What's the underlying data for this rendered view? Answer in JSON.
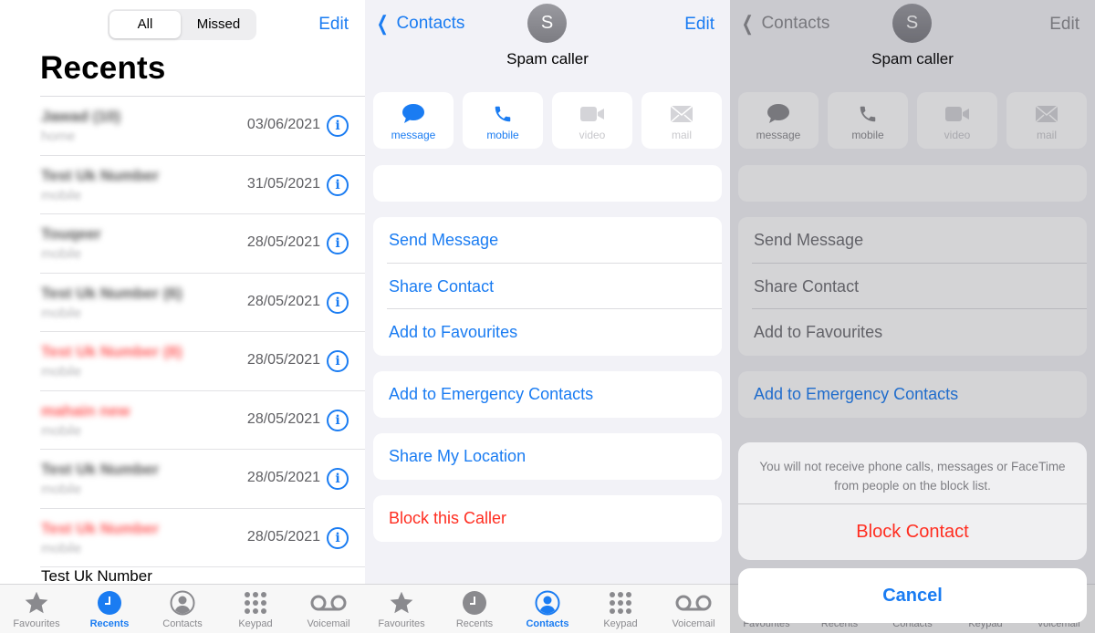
{
  "colors": {
    "accent": "#1a7cf2",
    "destructive": "#ff2d20",
    "missed": "#ff5a5a"
  },
  "recents": {
    "segment": {
      "all": "All",
      "missed": "Missed"
    },
    "edit": "Edit",
    "title": "Recents",
    "rows": [
      {
        "name": "Jawad (10)",
        "type": "home",
        "date": "03/06/2021",
        "missed": false
      },
      {
        "name": "Test Uk Number",
        "type": "mobile",
        "date": "31/05/2021",
        "missed": false
      },
      {
        "name": "Touqeer",
        "type": "mobile",
        "date": "28/05/2021",
        "missed": false
      },
      {
        "name": "Test Uk Number (6)",
        "type": "mobile",
        "date": "28/05/2021",
        "missed": false
      },
      {
        "name": "Test Uk Number (8)",
        "type": "mobile",
        "date": "28/05/2021",
        "missed": true
      },
      {
        "name": "mahain new",
        "type": "mobile",
        "date": "28/05/2021",
        "missed": true
      },
      {
        "name": "Test Uk Number",
        "type": "mobile",
        "date": "28/05/2021",
        "missed": false
      },
      {
        "name": "Test Uk Number",
        "type": "mobile",
        "date": "28/05/2021",
        "missed": true
      }
    ],
    "partial_row": "Test Uk Number",
    "info_glyph": "i"
  },
  "tabs": [
    {
      "label": "Favourites",
      "icon": "star-icon"
    },
    {
      "label": "Recents",
      "icon": "clock-icon"
    },
    {
      "label": "Contacts",
      "icon": "person-circle-icon"
    },
    {
      "label": "Keypad",
      "icon": "keypad-icon"
    },
    {
      "label": "Voicemail",
      "icon": "voicemail-icon"
    }
  ],
  "contact": {
    "back": "Contacts",
    "edit": "Edit",
    "initial": "S",
    "name": "Spam caller",
    "actions": [
      {
        "label": "message",
        "icon": "message-bubble-icon",
        "enabled": true
      },
      {
        "label": "mobile",
        "icon": "phone-icon",
        "enabled": true
      },
      {
        "label": "video",
        "icon": "video-camera-icon",
        "enabled": false
      },
      {
        "label": "mail",
        "icon": "mail-icon",
        "enabled": false
      }
    ],
    "rows": {
      "send_message": "Send Message",
      "share_contact": "Share Contact",
      "add_favourites": "Add to Favourites",
      "emergency": "Add to Emergency Contacts",
      "share_location": "Share My Location",
      "block": "Block this Caller"
    }
  },
  "block_sheet": {
    "message": "You will not receive phone calls, messages or FaceTime from people on the block list.",
    "confirm": "Block Contact",
    "cancel": "Cancel"
  }
}
